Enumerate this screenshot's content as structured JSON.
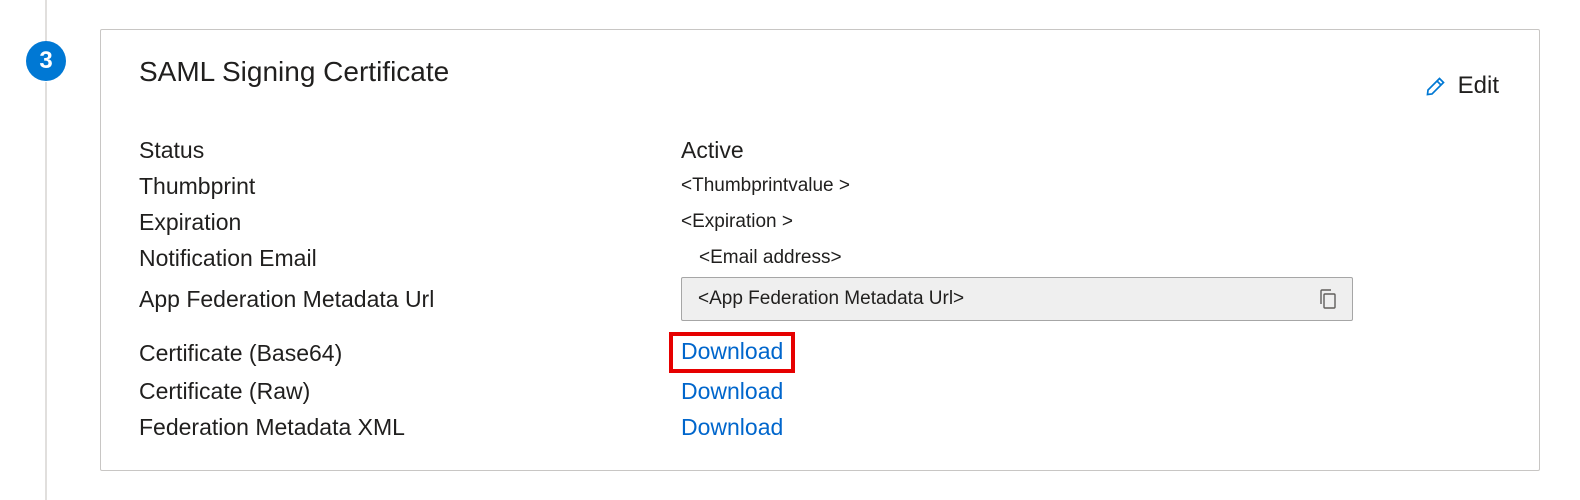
{
  "step": {
    "number": "3"
  },
  "section": {
    "title": "SAML Signing Certificate"
  },
  "actions": {
    "edit_label": "Edit"
  },
  "fields": {
    "status": {
      "label": "Status",
      "value": "Active"
    },
    "thumbprint": {
      "label": "Thumbprint",
      "value": "<Thumbprintvalue >"
    },
    "expiration": {
      "label": "Expiration",
      "value": "<Expiration >"
    },
    "notification_email": {
      "label": "Notification Email",
      "value": "<Email address>"
    },
    "federation_url": {
      "label": "App Federation Metadata Url",
      "value": "<App Federation Metadata Url>"
    },
    "cert_base64": {
      "label": "Certificate (Base64)",
      "link": "Download"
    },
    "cert_raw": {
      "label": "Certificate (Raw)",
      "link": "Download"
    },
    "federation_xml": {
      "label": "Federation Metadata XML",
      "link": "Download"
    }
  }
}
